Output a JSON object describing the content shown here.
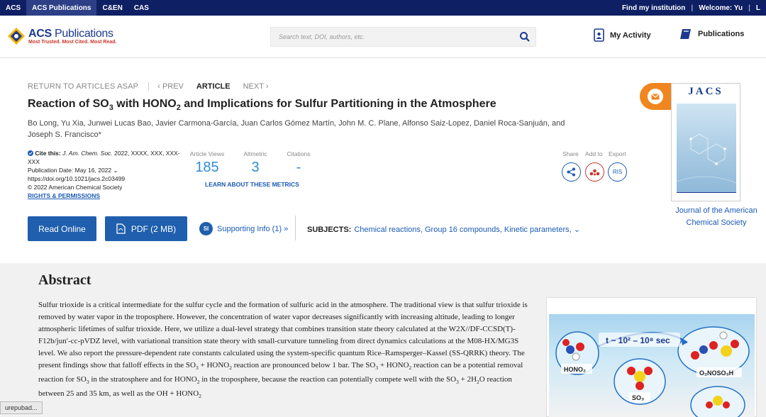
{
  "topbar": {
    "items": [
      "ACS",
      "ACS Publications",
      "C&EN",
      "CAS"
    ],
    "find_institution": "Find my institution",
    "welcome": "Welcome: Yu",
    "overflow": "L"
  },
  "header": {
    "logo_title_a": "ACS",
    "logo_title_b": "Publications",
    "logo_tagline": "Most Trusted. Most Cited. Most Read.",
    "search_placeholder": "Search text, DOI, authors, etc.",
    "my_activity": "My Activity",
    "publications": "Publications"
  },
  "nav": {
    "return": "RETURN TO ARTICLES ASAP",
    "prev": "‹ PREV",
    "article": "ARTICLE",
    "next": "NEXT ›"
  },
  "article": {
    "title_a": "Reaction of SO",
    "title_sub_a": "3",
    "title_b": " with HONO",
    "title_sub_b": "2",
    "title_c": " and Implications for Sulfur Partitioning in the Atmosphere",
    "authors": "Bo Long, Yu Xia, Junwei Lucas Bao, Javier Carmona-García, Juan Carlos Gómez Martín, John M. C. Plane, Alfonso Saiz-Lopez, Daniel Roca-Sanjuán, and Joseph S. Francisco*"
  },
  "meta": {
    "cite_label": "Cite this:",
    "cite_journal": "J. Am. Chem. Soc.",
    "cite_rest": " 2022, XXXX, XXX, XXX-XXX",
    "pub_date": "Publication Date: May 16, 2022",
    "doi": "https://doi.org/10.1021/jacs.2c03499",
    "copyright": "© 2022 American Chemical Society",
    "rights": "RIGHTS & PERMISSIONS"
  },
  "metrics": {
    "views_label": "Article Views",
    "views": "185",
    "altmetric_label": "Altmetric",
    "altmetric": "3",
    "citations_label": "Citations",
    "citations": "-",
    "learn": "LEARN ABOUT THESE METRICS"
  },
  "tools": {
    "share": "Share",
    "add_to": "Add to",
    "export": "Export",
    "ris": "RIS"
  },
  "actions": {
    "read_online": "Read Online",
    "pdf": "PDF (2 MB)",
    "si_badge": "SI",
    "supporting": "Supporting Info (1) »",
    "subjects_label": "SUBJECTS:",
    "subjects": "Chemical reactions, Group 16 compounds, Kinetic parameters,"
  },
  "journal": {
    "cover_title": "JACS",
    "name": "Journal of the American Chemical Society"
  },
  "abstract": {
    "heading": "Abstract",
    "p1": "Sulfur trioxide is a critical intermediate for the sulfur cycle and the formation of sulfuric acid in the atmosphere. The traditional view is that sulfur trioxide is removed by water vapor in the troposphere. However, the concentration of water vapor decreases significantly with increasing altitude, leading to longer atmospheric lifetimes of sulfur trioxide. Here, we utilize a dual-level strategy that combines transition state theory calculated at the W2X//DF-CCSD(T)-F12b/jun′-cc-pVDZ level, with variational transition state theory with small-curvature tunneling from direct dynamics calculations at the M08-HX/MG3S level. We also report the pressure-dependent rate constants calculated using the system-specific quantum Rice–Ramsperger–Kassel (SS-QRRK) theory. The present findings show that falloff effects in the SO",
    "p1_sub": "3",
    "p2": " + HONO",
    "p2_sub": "2",
    "p3": " reaction are pronounced below 1 bar. The SO",
    "p3_sub": "3",
    "p4": " + HONO",
    "p4_sub": "2",
    "p5": " reaction can be a potential removal reaction for SO",
    "p5_sub": "3",
    "p6": " in the stratosphere and for HONO",
    "p6_sub": "2",
    "p7": " in the troposphere, because the reaction can potentially compete well with the SO",
    "p7_sub": "3",
    "p8": " + 2H",
    "p8_sub": "2",
    "p9": "O reaction between 25 and 35 km, as well as the OH + HONO",
    "p9_sub": "2",
    "toc_rate": "t ~ 10² – 10⁸ sec",
    "toc_hono2": "HONO₂",
    "toc_so3": "SO₃",
    "toc_product": "O₂NOSO₃H"
  },
  "status_bar": "urepubad..."
}
